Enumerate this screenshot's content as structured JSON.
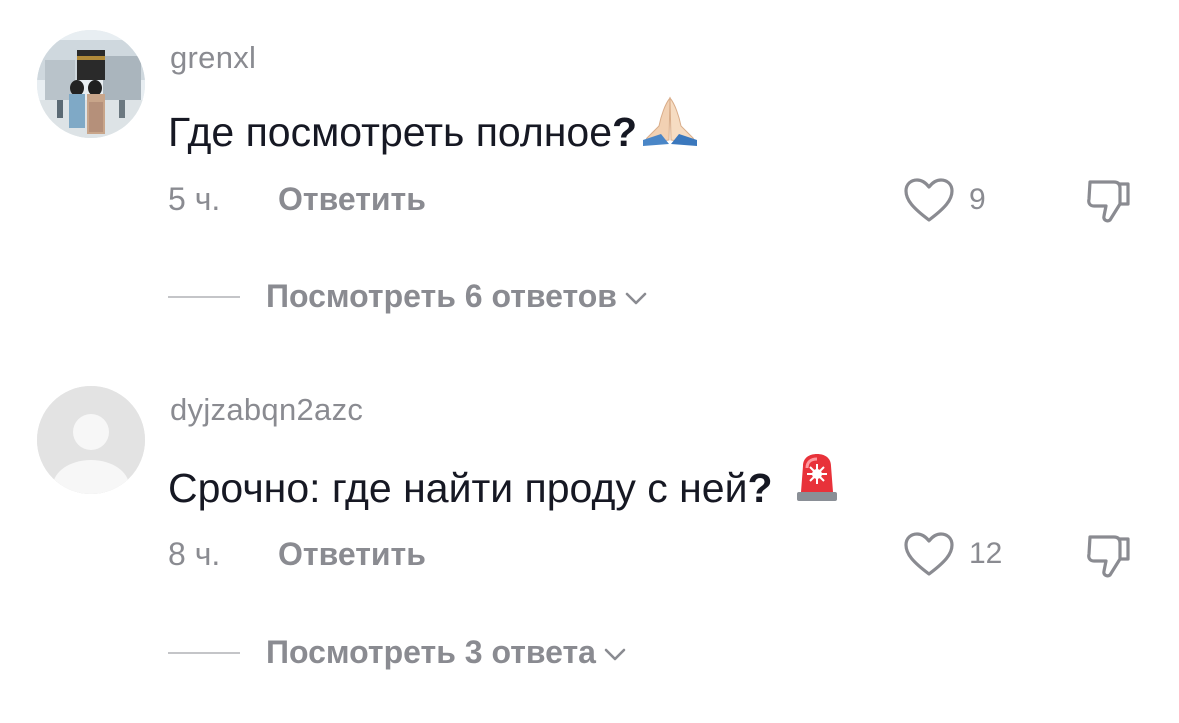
{
  "comments": [
    {
      "username": "grenxl",
      "text": "Где посмотреть полное",
      "punct": "?",
      "emoji": "folded-hands",
      "time": "5 ч.",
      "reply_label": "Ответить",
      "likes": "9",
      "view_replies": "Посмотреть 6 ответов"
    },
    {
      "username": "dyjzabqn2azc",
      "text": "Срочно: где найти проду с ней",
      "punct": "?",
      "emoji": "police-light",
      "time": "8 ч.",
      "reply_label": "Ответить",
      "likes": "12",
      "view_replies": "Посмотреть 3 ответа"
    }
  ],
  "colors": {
    "text_primary": "#161823",
    "text_secondary": "#8a8b91",
    "divider": "#c4c5c8"
  }
}
